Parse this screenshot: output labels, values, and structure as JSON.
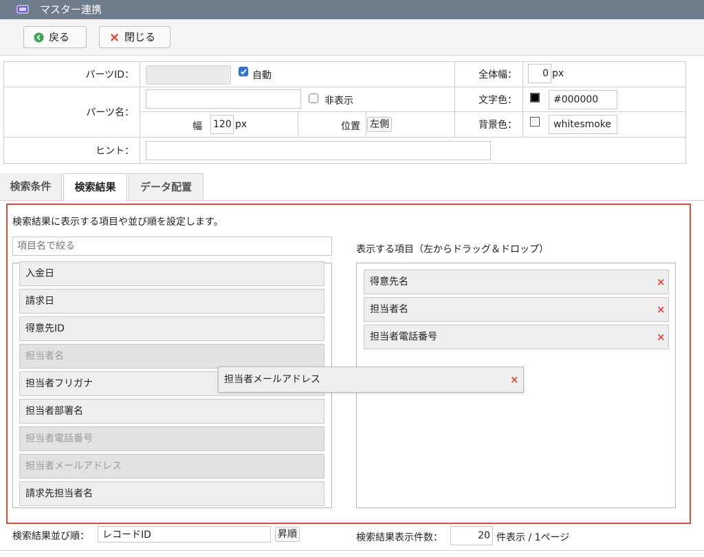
{
  "window": {
    "title": "マスター連携",
    "icon": "app-window-icon"
  },
  "toolbar": {
    "back_label": "戻る",
    "back_icon": "arrow-left-circle-icon",
    "close_label": "閉じる",
    "close_icon": "x-icon"
  },
  "props": {
    "parts_id_label": "パーツID：",
    "auto_label": "自動",
    "auto_checked": true,
    "total_width_label": "全体幅：",
    "total_width_value": "0",
    "total_width_unit": "px",
    "parts_name_label": "パーツ名：",
    "parts_name_value": "",
    "hide_label": "非表示",
    "hide_checked": false,
    "text_color_label": "文字色：",
    "text_color_value": "#000000",
    "text_color_swatch": "#000000",
    "width_label": "幅",
    "width_value": "120",
    "width_unit": "px",
    "position_label": "位置",
    "position_value": "左側",
    "bg_color_label": "背景色：",
    "bg_color_value": "whitesmoke",
    "bg_color_swatch": "#f5f5f5",
    "hint_label": "ヒント：",
    "hint_value": ""
  },
  "tabs": [
    {
      "label": "検索条件",
      "active": false
    },
    {
      "label": "検索結果",
      "active": true
    },
    {
      "label": "データ配置",
      "active": false
    }
  ],
  "panel": {
    "description": "検索結果に表示する項目や並び順を設定します。",
    "filter_placeholder": "項目名で絞る",
    "right_title": "表示する項目（左からドラッグ＆ドロップ）",
    "available_items": [
      {
        "label": "入金日",
        "used": false
      },
      {
        "label": "請求日",
        "used": false
      },
      {
        "label": "得意先ID",
        "used": false
      },
      {
        "label": "担当者名",
        "used": true
      },
      {
        "label": "担当者フリガナ",
        "used": false
      },
      {
        "label": "担当者部署名",
        "used": false
      },
      {
        "label": "担当者電話番号",
        "used": true
      },
      {
        "label": "担当者メールアドレス",
        "used": true
      },
      {
        "label": "請求先担当者名",
        "used": false
      }
    ],
    "selected_items": [
      "得意先名",
      "担当者名",
      "担当者電話番号"
    ],
    "dragging_item": "担当者メールアドレス",
    "remove_glyph": "×"
  },
  "footer": {
    "sort_label": "検索結果並び順：",
    "sort_value": "レコードID",
    "sort_order": "昇順",
    "count_label": "検索結果表示件数：",
    "count_value": "20",
    "count_suffix": "件表示 / 1ページ"
  },
  "colors": {
    "accent_red": "#e04a35",
    "checkbox_blue": "#2d73e0",
    "titlebar": "#6e7b8b",
    "back_green": "#3aa655"
  }
}
